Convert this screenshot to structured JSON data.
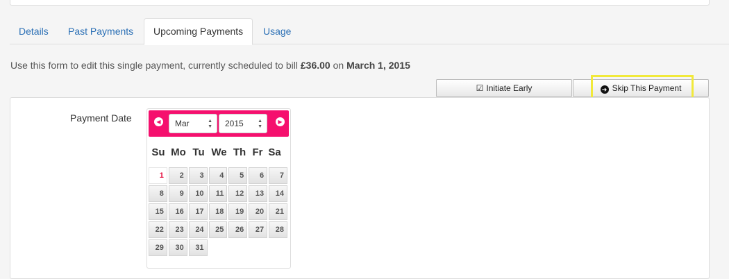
{
  "tabs": [
    "Details",
    "Past Payments",
    "Upcoming Payments",
    "Usage"
  ],
  "intro": {
    "prefix": "Use this form to edit this single payment, currently scheduled to bill ",
    "amount": "£36.00",
    "middle": " on ",
    "date": "March 1, 2015"
  },
  "buttons": {
    "initiate_early": "Initiate Early",
    "skip_payment": "Skip This Payment"
  },
  "form": {
    "payment_date_label": "Payment Date"
  },
  "datepicker": {
    "month": "Mar",
    "year": "2015",
    "weekdays": [
      "Su",
      "Mo",
      "Tu",
      "We",
      "Th",
      "Fr",
      "Sa"
    ],
    "days": [
      "1",
      "2",
      "3",
      "4",
      "5",
      "6",
      "7",
      "8",
      "9",
      "10",
      "11",
      "12",
      "13",
      "14",
      "15",
      "16",
      "17",
      "18",
      "19",
      "20",
      "21",
      "22",
      "23",
      "24",
      "25",
      "26",
      "27",
      "28",
      "29",
      "30",
      "31"
    ],
    "selected_day": "1"
  },
  "colors": {
    "accent": "#f5106e",
    "link": "#2a6fb5",
    "highlight": "#f1e93a"
  }
}
